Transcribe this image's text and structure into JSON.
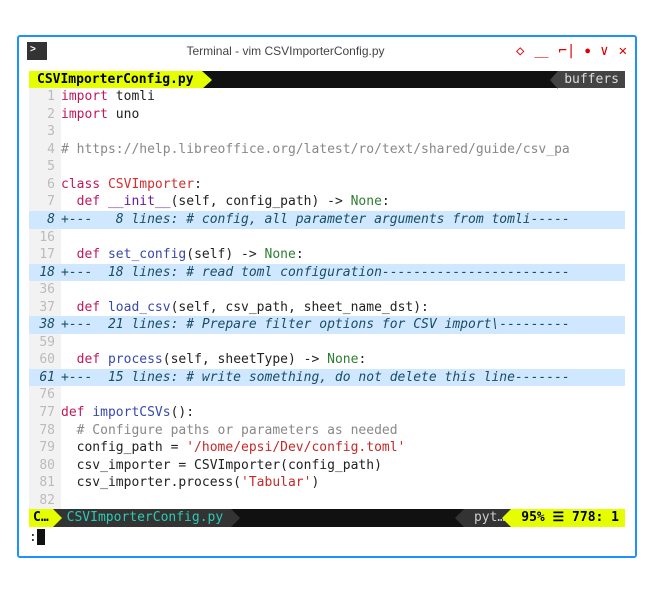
{
  "window": {
    "title": "Terminal - vim CSVImporterConfig.py"
  },
  "tabbar": {
    "active": "CSVImporterConfig.py",
    "right": "buffers"
  },
  "lines": [
    {
      "num": "1",
      "cls": "",
      "html": "<span class='kw-import'>import</span> tomli"
    },
    {
      "num": "2",
      "cls": "",
      "html": "<span class='kw-import'>import</span> uno"
    },
    {
      "num": "3",
      "cls": "",
      "html": ""
    },
    {
      "num": "4",
      "cls": "",
      "html": "<span class='comment'># https://help.libreoffice.org/latest/ro/text/shared/guide/csv_pa</span>"
    },
    {
      "num": "5",
      "cls": "",
      "html": ""
    },
    {
      "num": "6",
      "cls": "",
      "html": "<span class='kw-class'>class</span> <span class='cls-name'>CSVImporter</span>:"
    },
    {
      "num": "7",
      "cls": "",
      "html": "  <span class='kw-def'>def</span> <span class='fn-dunder'>__init__</span>(self, config_path) -&gt; <span class='type'>None</span>:"
    },
    {
      "num": "8",
      "cls": "fold",
      "html": "+---   8 lines: # config, all parameter arguments from tomli-----"
    },
    {
      "num": "16",
      "cls": "",
      "html": ""
    },
    {
      "num": "17",
      "cls": "",
      "html": "  <span class='kw-def'>def</span> <span class='fn-name'>set_config</span>(self) -&gt; <span class='type'>None</span>:"
    },
    {
      "num": "18",
      "cls": "fold",
      "html": "+---  18 lines: # read toml configuration------------------------"
    },
    {
      "num": "36",
      "cls": "",
      "html": ""
    },
    {
      "num": "37",
      "cls": "",
      "html": "  <span class='kw-def'>def</span> <span class='fn-name'>load_csv</span>(self, csv_path, sheet_name_dst):"
    },
    {
      "num": "38",
      "cls": "fold",
      "html": "+---  21 lines: # Prepare filter options for CSV import\\---------"
    },
    {
      "num": "59",
      "cls": "",
      "html": ""
    },
    {
      "num": "60",
      "cls": "",
      "html": "  <span class='kw-def'>def</span> <span class='fn-name'>process</span>(self, sheetType) -&gt; <span class='type'>None</span>:"
    },
    {
      "num": "61",
      "cls": "fold",
      "html": "+---  15 lines: # write something, do not delete this line-------"
    },
    {
      "num": "76",
      "cls": "",
      "html": ""
    },
    {
      "num": "77",
      "cls": "",
      "html": "<span class='kw-def'>def</span> <span class='fn-name'>importCSVs</span>():"
    },
    {
      "num": "78",
      "cls": "",
      "html": "  <span class='comment'># Configure paths or parameters as needed</span>"
    },
    {
      "num": "79",
      "cls": "",
      "html": "  config_path = <span class='string'>'/home/epsi/Dev/config.toml'</span>"
    },
    {
      "num": "80",
      "cls": "",
      "html": "  csv_importer = CSVImporter(config_path)"
    },
    {
      "num": "81",
      "cls": "",
      "html": "  csv_importer.process(<span class='string'>'Tabular'</span>)"
    },
    {
      "num": "82",
      "cls": "",
      "html": ""
    }
  ],
  "status": {
    "mode": "C…",
    "file": "CSVImporterConfig.py",
    "filetype": "pyt…",
    "pos": "95% ☰  778: 1"
  },
  "cmdline": ":"
}
